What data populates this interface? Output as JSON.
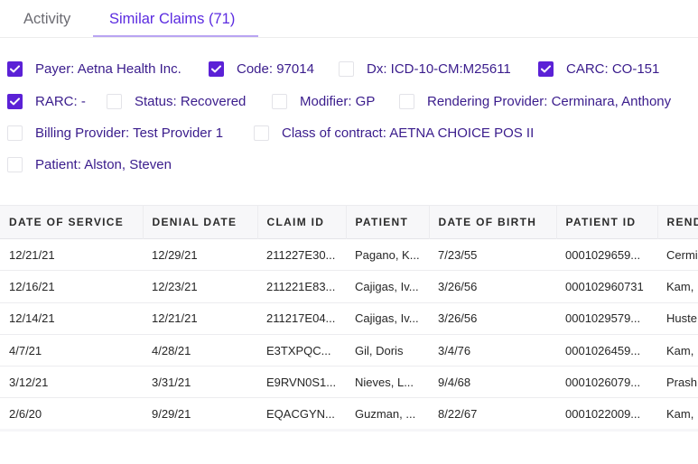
{
  "tabs": [
    {
      "label": "Activity",
      "active": false
    },
    {
      "label": "Similar Claims (71)",
      "active": true
    }
  ],
  "colors": {
    "accent": "#5b21d6",
    "tab_active_text": "#5b2be0",
    "tab_underline": "#b9a4f2",
    "filter_text": "#3a1c8c",
    "header_bg": "#f7f7f9"
  },
  "filters": [
    {
      "label": "Payer: Aetna Health Inc.",
      "checked": true
    },
    {
      "label": "Code: 97014",
      "checked": true
    },
    {
      "label": "Dx: ICD-10-CM:M25611",
      "checked": false
    },
    {
      "label": "CARC: CO-151",
      "checked": true
    },
    {
      "label": "RARC: -",
      "checked": true
    },
    {
      "label": "Status: Recovered",
      "checked": false
    },
    {
      "label": "Modifier: GP",
      "checked": false
    },
    {
      "label": "Rendering Provider: Cerminara, Anthony",
      "checked": false
    },
    {
      "label": "Billing Provider: Test Provider 1",
      "checked": false
    },
    {
      "label": "Class of contract: AETNA CHOICE POS II",
      "checked": false
    },
    {
      "label": "Patient: Alston, Steven",
      "checked": false
    }
  ],
  "table": {
    "columns": [
      "DATE OF SERVICE",
      "DENIAL DATE",
      "CLAIM ID",
      "PATIENT",
      "DATE OF BIRTH",
      "PATIENT ID",
      "REND"
    ],
    "rows": [
      [
        "12/21/21",
        "12/29/21",
        "211227E30...",
        "Pagano, K...",
        "7/23/55",
        "0001029659...",
        "Cermi"
      ],
      [
        "12/16/21",
        "12/23/21",
        "211221E83...",
        "Cajigas, Iv...",
        "3/26/56",
        "000102960731",
        "Kam,"
      ],
      [
        "12/14/21",
        "12/21/21",
        "211217E04...",
        "Cajigas, Iv...",
        "3/26/56",
        "0001029579...",
        "Huste"
      ],
      [
        "4/7/21",
        "4/28/21",
        "E3TXPQC...",
        "Gil, Doris",
        "3/4/76",
        "0001026459...",
        "Kam,"
      ],
      [
        "3/12/21",
        "3/31/21",
        "E9RVN0S1...",
        "Nieves, L...",
        "9/4/68",
        "0001026079...",
        "Prash"
      ],
      [
        "2/6/20",
        "9/29/21",
        "EQACGYN...",
        "Guzman, ...",
        "8/22/67",
        "0001022009...",
        "Kam,"
      ]
    ]
  }
}
